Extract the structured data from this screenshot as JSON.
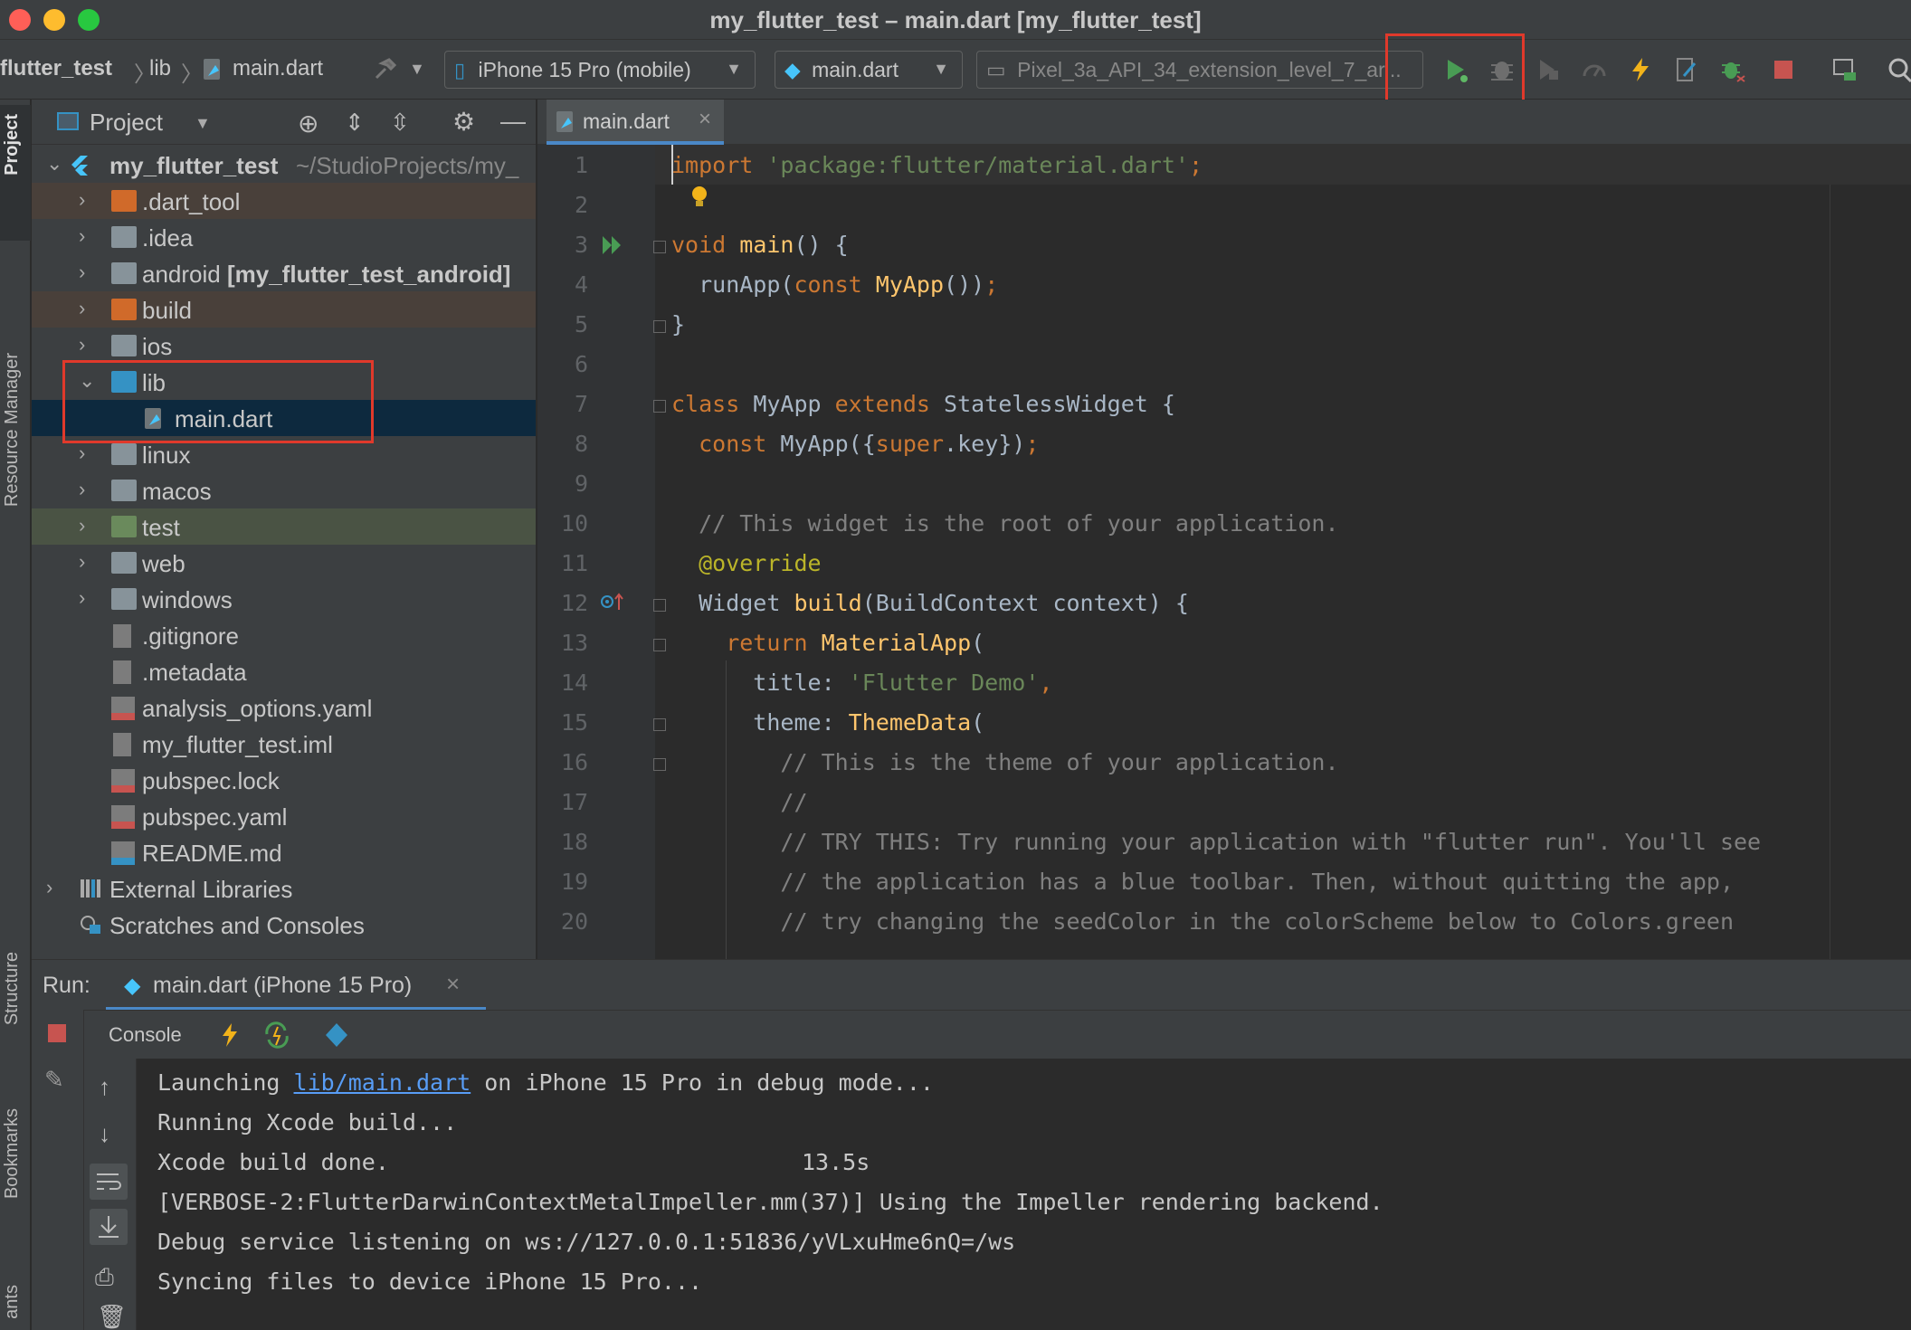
{
  "window": {
    "title": "my_flutter_test – main.dart [my_flutter_test]"
  },
  "toolbar": {
    "breadcrumb_project": "flutter_test",
    "breadcrumb_lib": "lib",
    "breadcrumb_file": "main.dart",
    "device_selector": "iPhone 15 Pro (mobile)",
    "run_config": "main.dart",
    "emulator_selector": "Pixel_3a_API_34_extension_level_7_ar..."
  },
  "sidebar_strip": {
    "project": "Project",
    "resource_manager": "Resource Manager",
    "structure": "Structure",
    "bookmarks": "Bookmarks",
    "variants": "ants"
  },
  "project_panel": {
    "title": "Project",
    "root_name": "my_flutter_test",
    "root_path": "~/StudioProjects/my_",
    "items": [
      {
        "label": ".dart_tool",
        "bold": ""
      },
      {
        "label": ".idea",
        "bold": ""
      },
      {
        "label": "android ",
        "bold": "[my_flutter_test_android]"
      },
      {
        "label": "build",
        "bold": ""
      },
      {
        "label": "ios",
        "bold": ""
      },
      {
        "label": "lib",
        "bold": ""
      },
      {
        "label": "main.dart",
        "bold": ""
      },
      {
        "label": "linux",
        "bold": ""
      },
      {
        "label": "macos",
        "bold": ""
      },
      {
        "label": "test",
        "bold": ""
      },
      {
        "label": "web",
        "bold": ""
      },
      {
        "label": "windows",
        "bold": ""
      },
      {
        "label": ".gitignore",
        "bold": ""
      },
      {
        "label": ".metadata",
        "bold": ""
      },
      {
        "label": "analysis_options.yaml",
        "bold": ""
      },
      {
        "label": "my_flutter_test.iml",
        "bold": ""
      },
      {
        "label": "pubspec.lock",
        "bold": ""
      },
      {
        "label": "pubspec.yaml",
        "bold": ""
      },
      {
        "label": "README.md",
        "bold": ""
      },
      {
        "label": "External Libraries",
        "bold": ""
      },
      {
        "label": "Scratches and Consoles",
        "bold": ""
      }
    ]
  },
  "editor": {
    "tab_label": "main.dart",
    "lines": [
      {
        "n": "1",
        "segs": [
          [
            "kw",
            "import "
          ],
          [
            "str",
            "'package:flutter/material.dart'"
          ],
          [
            "kw",
            ";"
          ]
        ]
      },
      {
        "n": "2",
        "segs": []
      },
      {
        "n": "3",
        "segs": [
          [
            "kw",
            "void "
          ],
          [
            "fn",
            "main"
          ],
          [
            "pl",
            "() {"
          ]
        ]
      },
      {
        "n": "4",
        "segs": [
          [
            "pl",
            "  runApp("
          ],
          [
            "kw",
            "const "
          ],
          [
            "fn",
            "MyApp"
          ],
          [
            "pl",
            "())"
          ],
          [
            "kw",
            ";"
          ]
        ]
      },
      {
        "n": "5",
        "segs": [
          [
            "pl",
            "}"
          ]
        ]
      },
      {
        "n": "6",
        "segs": []
      },
      {
        "n": "7",
        "segs": [
          [
            "kw",
            "class "
          ],
          [
            "pl",
            "MyApp "
          ],
          [
            "kw",
            "extends "
          ],
          [
            "pl",
            "StatelessWidget {"
          ]
        ]
      },
      {
        "n": "8",
        "segs": [
          [
            "kw",
            "  const "
          ],
          [
            "pl",
            "MyApp({"
          ],
          [
            "kw",
            "super"
          ],
          [
            "pl",
            ".key})"
          ],
          [
            "kw",
            ";"
          ]
        ]
      },
      {
        "n": "9",
        "segs": []
      },
      {
        "n": "10",
        "segs": [
          [
            "cm",
            "  // This widget is the root of your application."
          ]
        ]
      },
      {
        "n": "11",
        "segs": [
          [
            "anno",
            "  @override"
          ]
        ]
      },
      {
        "n": "12",
        "segs": [
          [
            "pl",
            "  Widget "
          ],
          [
            "fn",
            "build"
          ],
          [
            "pl",
            "(BuildContext context) {"
          ]
        ]
      },
      {
        "n": "13",
        "segs": [
          [
            "kw",
            "    return "
          ],
          [
            "fn",
            "MaterialApp"
          ],
          [
            "pl",
            "("
          ]
        ]
      },
      {
        "n": "14",
        "segs": [
          [
            "pl",
            "      title: "
          ],
          [
            "str",
            "'Flutter Demo'"
          ],
          [
            "kw",
            ","
          ]
        ]
      },
      {
        "n": "15",
        "segs": [
          [
            "pl",
            "      theme: "
          ],
          [
            "fn",
            "ThemeData"
          ],
          [
            "pl",
            "("
          ]
        ]
      },
      {
        "n": "16",
        "segs": [
          [
            "cm",
            "        // This is the theme of your application."
          ]
        ]
      },
      {
        "n": "17",
        "segs": [
          [
            "cm",
            "        //"
          ]
        ]
      },
      {
        "n": "18",
        "segs": [
          [
            "cm",
            "        // TRY THIS: Try running your application with \"flutter run\". You'll see"
          ]
        ]
      },
      {
        "n": "19",
        "segs": [
          [
            "cm",
            "        // the application has a blue toolbar. Then, without quitting the app,"
          ]
        ]
      },
      {
        "n": "20",
        "segs": [
          [
            "cm",
            "        // try changing the seedColor in the colorScheme below to Colors.green"
          ]
        ]
      }
    ]
  },
  "run_panel": {
    "run_label": "Run:",
    "tab_label": "main.dart (iPhone 15 Pro)",
    "console_label": "Console",
    "console": {
      "line1_prefix": "Launching ",
      "line1_link": "lib/main.dart",
      "line1_suffix": " on iPhone 15 Pro in debug mode...",
      "line2": "Running Xcode build...",
      "line3": "Xcode build done.",
      "line3_time": "13.5s",
      "line4": "[VERBOSE-2:FlutterDarwinContextMetalImpeller.mm(37)] Using the Impeller rendering backend.",
      "line5": "Debug service listening on ws://127.0.0.1:51836/yVLxuHme6nQ=/ws",
      "line6": "Syncing files to device iPhone 15 Pro..."
    }
  },
  "colors": {
    "highlight": "#e0392b",
    "run_green": "#499c54",
    "stop_red": "#c75450",
    "flutter_blue": "#47c5fb"
  }
}
